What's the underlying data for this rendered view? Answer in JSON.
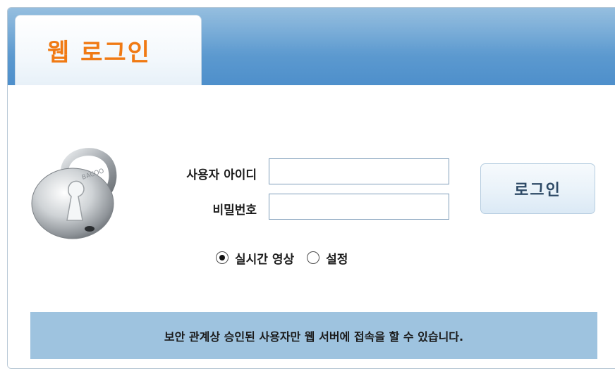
{
  "header": {
    "tab_title": "웹 로그인"
  },
  "form": {
    "user_id_label": "사용자 아이디",
    "password_label": "비밀번호",
    "user_id_value": "",
    "password_value": "",
    "login_button_label": "로그인"
  },
  "mode": {
    "options": [
      {
        "label": "실시간 영상",
        "selected": true
      },
      {
        "label": "설정",
        "selected": false
      }
    ]
  },
  "notice": {
    "text": "보안 관계상 승인된 사용자만 웹 서버에 접속을 할 수 있습니다."
  },
  "icons": {
    "lock": "padlock-icon",
    "lock_engraving": "BACOO"
  },
  "colors": {
    "header_blue": "#5e9bd0",
    "title_orange": "#f07a14",
    "notice_bg": "#9ec3df"
  }
}
